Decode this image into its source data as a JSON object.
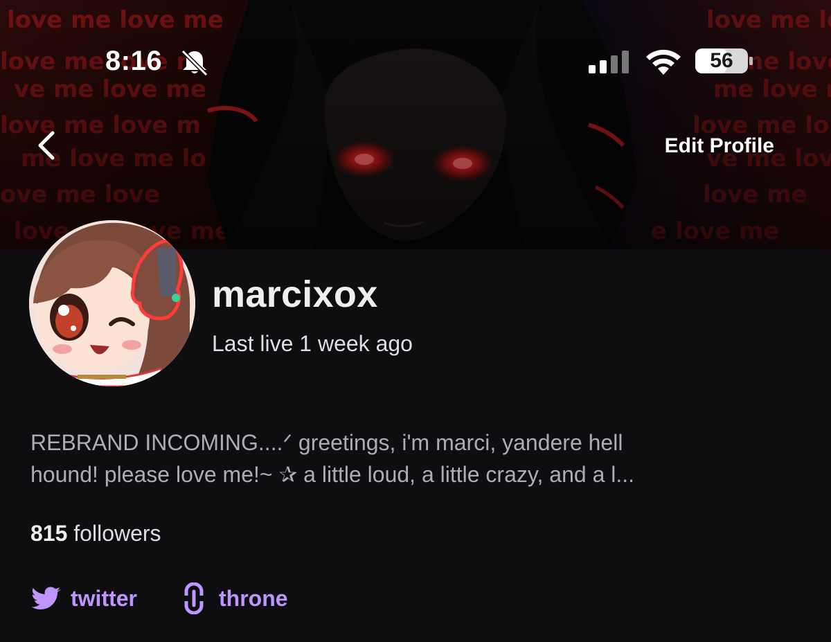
{
  "status_bar": {
    "time": "8:16",
    "battery": "56",
    "icons": [
      "bell-off-icon",
      "cellular-signal-icon",
      "wifi-icon",
      "battery-icon"
    ]
  },
  "nav": {
    "back_icon": "chevron-left-icon",
    "edit_profile_label": "Edit Profile"
  },
  "banner": {
    "text_tiles": [
      "love",
      "me",
      "love",
      "me",
      "love",
      "me",
      "love"
    ]
  },
  "profile": {
    "username": "marcixox",
    "last_live": "Last live 1 week ago",
    "bio_line1": "REBRAND INCOMING....ᐟ greetings, i'm marci, yandere hell",
    "bio_line2": "hound! please love me!~ ✰ a little loud, a little crazy, and a l...",
    "followers_count": "815",
    "followers_label": "followers"
  },
  "social_links": [
    {
      "label": "twitter",
      "icon": "twitter-bird-icon"
    },
    {
      "label": "throne",
      "icon": "link-icon"
    }
  ],
  "colors": {
    "background": "#0e0e10",
    "accent": "#bf94ff",
    "banner_red": "#ff2a2a"
  }
}
